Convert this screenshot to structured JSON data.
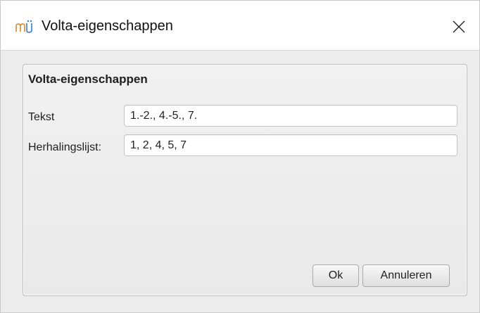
{
  "window": {
    "title": "Volta-eigenschappen",
    "app_icon": "musescore-notes-icon",
    "close_icon": "close-icon"
  },
  "group": {
    "title": "Volta-eigenschappen"
  },
  "fields": {
    "text": {
      "label": "Tekst",
      "value": "1.-2., 4.-5., 7."
    },
    "repeat_list": {
      "label": "Herhalingslijst:",
      "value": "1, 2, 4, 5, 7"
    }
  },
  "buttons": {
    "ok": "Ok",
    "cancel": "Annuleren"
  }
}
